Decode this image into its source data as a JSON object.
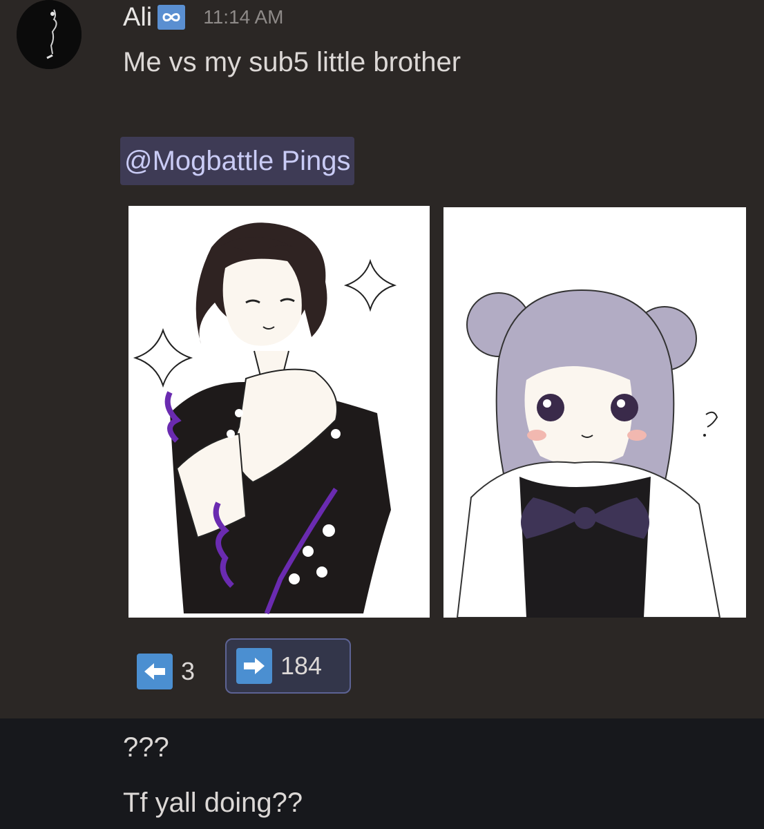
{
  "message": {
    "author": "Ali",
    "badge_icon": "infinity-icon",
    "timestamp": "11:14 AM",
    "text_line": "Me vs my sub5 little brother",
    "mention": "@Mogbattle Pings",
    "attachments": [
      {
        "icon": "drawing-dark-hair-character"
      },
      {
        "icon": "drawing-lavender-hair-character"
      }
    ],
    "reactions": [
      {
        "icon": "arrow-left-emoji",
        "count": "3",
        "selected": false
      },
      {
        "icon": "arrow-right-emoji",
        "count": "184",
        "selected": true
      }
    ]
  },
  "followup": {
    "line1": "???",
    "line2": "Tf yall doing??"
  },
  "colors": {
    "background": "#2b2725",
    "bottom_background": "#17181c",
    "mention_bg": "#3e3b55",
    "mention_text": "#c9cbf5",
    "emoji_blue": "#4b8fd1",
    "selected_reaction_border": "#5d6394"
  }
}
